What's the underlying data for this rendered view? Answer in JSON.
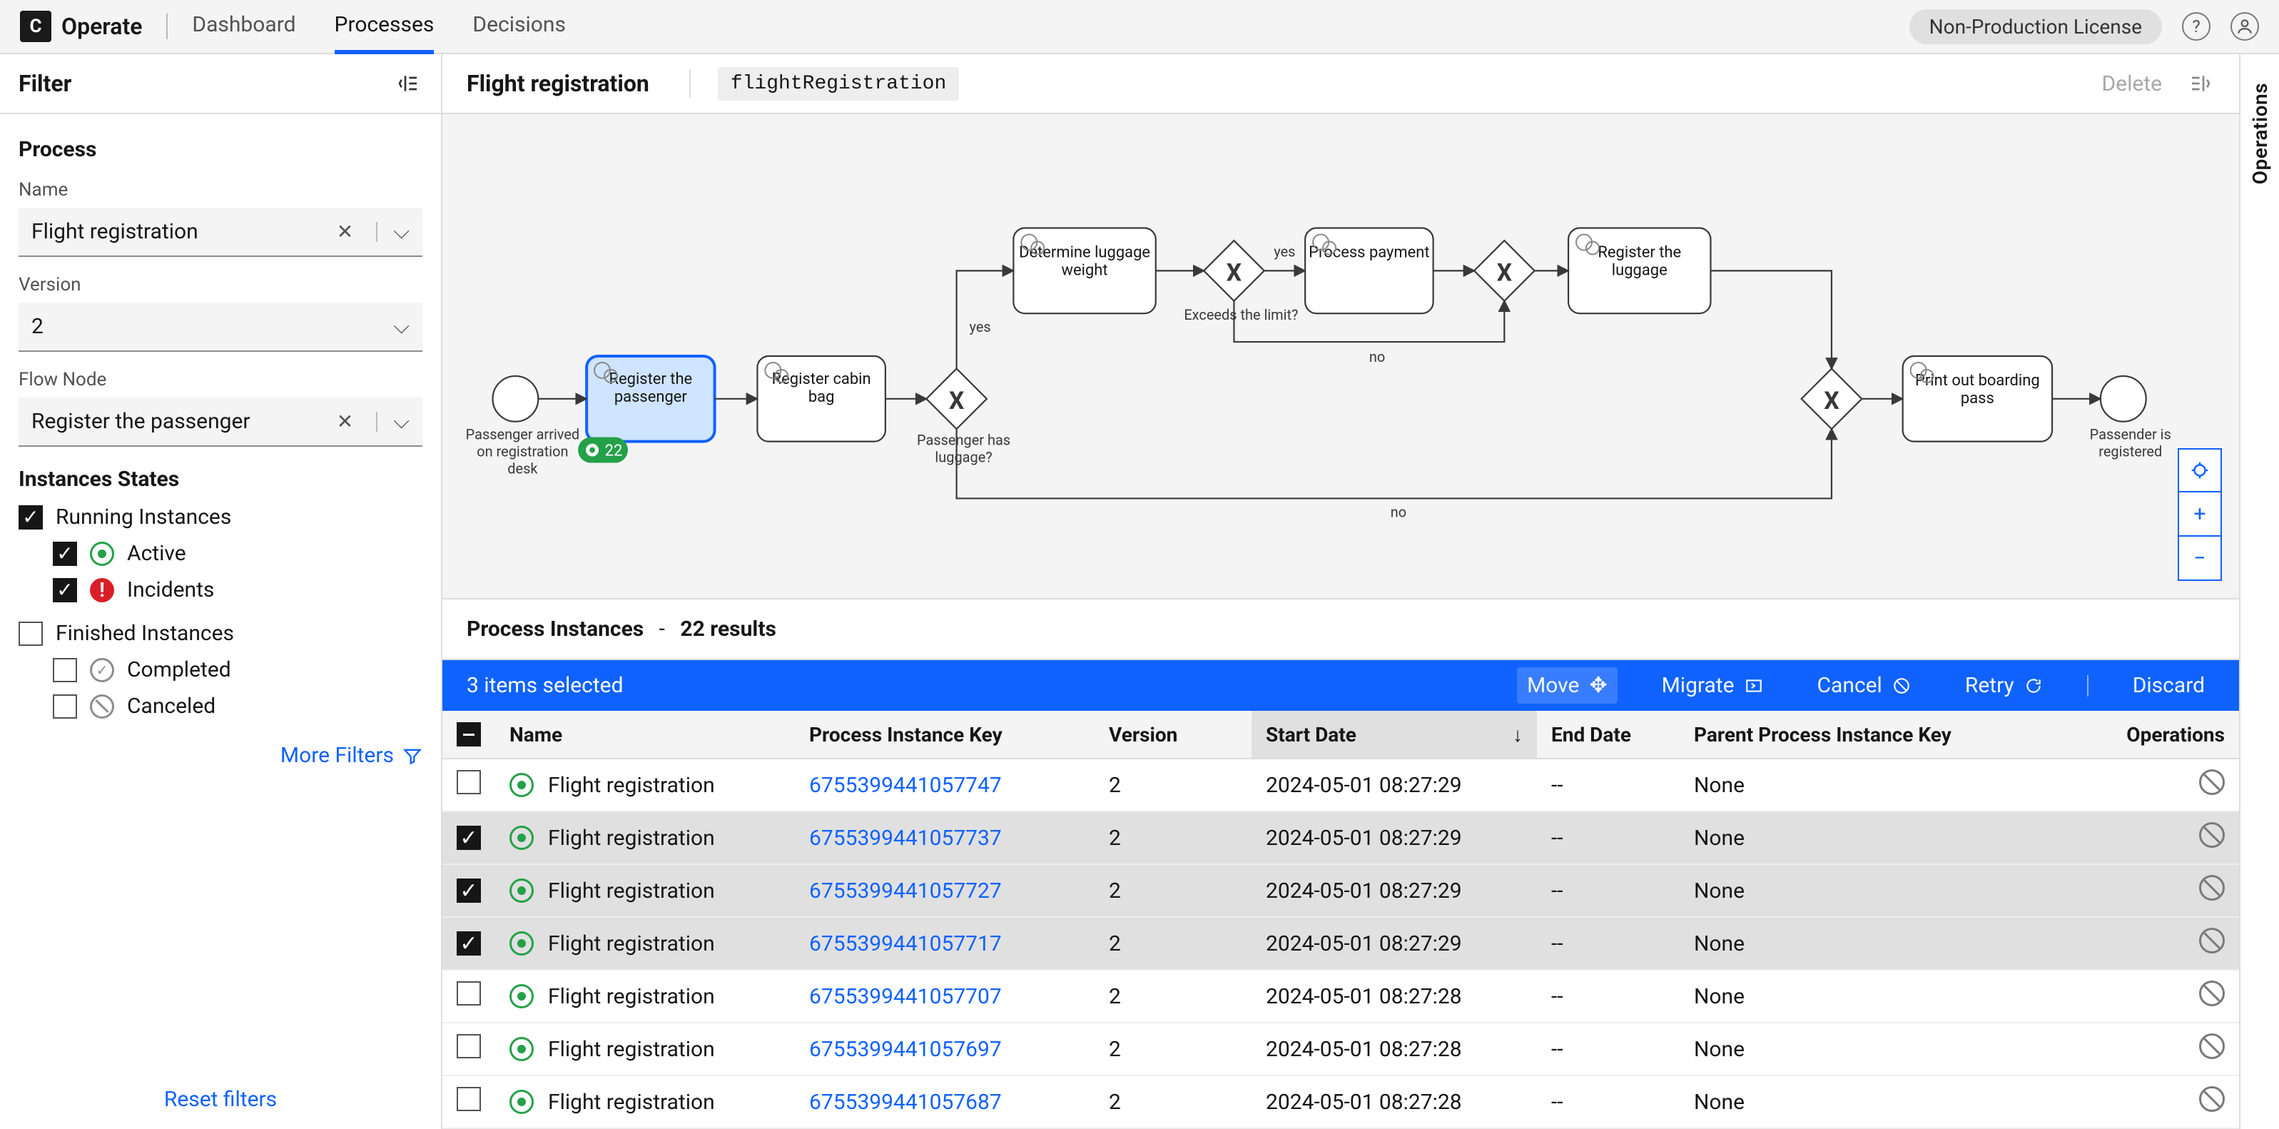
{
  "header": {
    "brand_initial": "C",
    "app_name": "Operate",
    "nav": {
      "dashboard": "Dashboard",
      "processes": "Processes",
      "decisions": "Decisions"
    },
    "license": "Non-Production License",
    "help_glyph": "?"
  },
  "sidebar": {
    "title": "Filter",
    "section_process": "Process",
    "labels": {
      "name": "Name",
      "version": "Version",
      "flow_node": "Flow Node"
    },
    "values": {
      "name": "Flight registration",
      "version": "2",
      "flow_node": "Register the passenger"
    },
    "section_states": "Instances States",
    "states": {
      "running": "Running Instances",
      "active": "Active",
      "incidents": "Incidents",
      "finished": "Finished Instances",
      "completed": "Completed",
      "canceled": "Canceled"
    },
    "more_filters": "More Filters",
    "reset": "Reset filters"
  },
  "main": {
    "title": "Flight registration",
    "slug": "flightRegistration",
    "delete": "Delete"
  },
  "diagram": {
    "start_label": "Passenger arrived on registration desk",
    "tasks": {
      "register_passenger": "Register the passenger",
      "register_cabin_bag": "Register cabin bag",
      "determine_luggage": "Determine luggage weight",
      "process_payment": "Process payment",
      "register_luggage": "Register the luggage",
      "print_pass": "Print out boarding pass"
    },
    "gateways": {
      "has_luggage": "Passenger has luggage?",
      "exceeds_limit": "Exceeds the limit?"
    },
    "edge_labels": {
      "yes": "yes",
      "no": "no"
    },
    "end_label": "Passender is registered",
    "badge_value": "22"
  },
  "instances": {
    "header_title": "Process Instances",
    "result_count": "22 results",
    "selection_bar": {
      "count_text": "3 items selected",
      "move": "Move",
      "migrate": "Migrate",
      "cancel": "Cancel",
      "retry": "Retry",
      "discard": "Discard"
    },
    "columns": {
      "name": "Name",
      "key": "Process Instance Key",
      "version": "Version",
      "start": "Start Date",
      "end": "End Date",
      "parent": "Parent Process Instance Key",
      "ops": "Operations"
    },
    "rows": [
      {
        "selected": false,
        "name": "Flight registration",
        "key": "6755399441057747",
        "version": "2",
        "start": "2024-05-01 08:27:29",
        "end": "--",
        "parent": "None"
      },
      {
        "selected": true,
        "name": "Flight registration",
        "key": "6755399441057737",
        "version": "2",
        "start": "2024-05-01 08:27:29",
        "end": "--",
        "parent": "None"
      },
      {
        "selected": true,
        "name": "Flight registration",
        "key": "6755399441057727",
        "version": "2",
        "start": "2024-05-01 08:27:29",
        "end": "--",
        "parent": "None"
      },
      {
        "selected": true,
        "name": "Flight registration",
        "key": "6755399441057717",
        "version": "2",
        "start": "2024-05-01 08:27:29",
        "end": "--",
        "parent": "None"
      },
      {
        "selected": false,
        "name": "Flight registration",
        "key": "6755399441057707",
        "version": "2",
        "start": "2024-05-01 08:27:28",
        "end": "--",
        "parent": "None"
      },
      {
        "selected": false,
        "name": "Flight registration",
        "key": "6755399441057697",
        "version": "2",
        "start": "2024-05-01 08:27:28",
        "end": "--",
        "parent": "None"
      },
      {
        "selected": false,
        "name": "Flight registration",
        "key": "6755399441057687",
        "version": "2",
        "start": "2024-05-01 08:27:28",
        "end": "--",
        "parent": "None"
      }
    ]
  },
  "rail": {
    "label": "Operations"
  },
  "zoom": {
    "fit": "⊕",
    "plus": "+",
    "minus": "−"
  }
}
